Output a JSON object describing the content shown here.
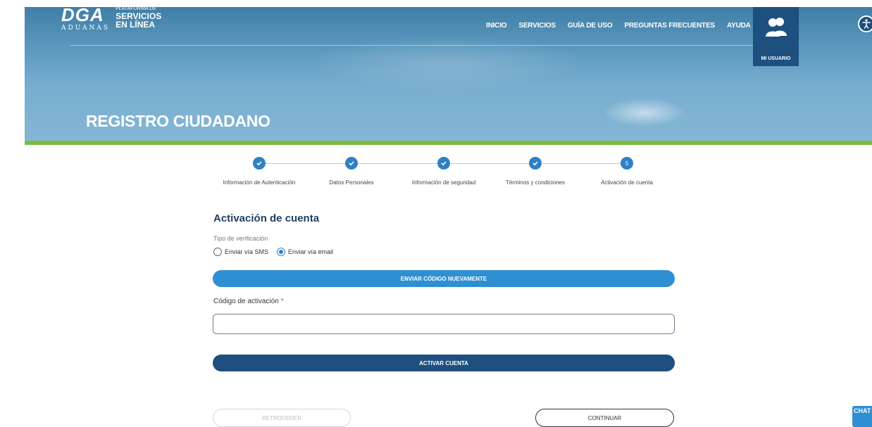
{
  "header": {
    "logo": {
      "mark": "DGA",
      "subtitle": "ADUANAS",
      "tagline_small": "PLATAFORMA DE",
      "tagline_line1": "SERVICIOS",
      "tagline_line2": "EN LÍNEA"
    },
    "nav": [
      "INICIO",
      "SERVICIOS",
      "GUÍA DE USO",
      "PREGUNTAS FRECUENTES",
      "AYUDA"
    ],
    "user_label": "MI USUARIO",
    "page_title": "REGISTRO CIUDADANO"
  },
  "stepper": {
    "steps": [
      {
        "label": "Información de Autenticación",
        "state": "done",
        "marker": ""
      },
      {
        "label": "Datos Personales",
        "state": "done",
        "marker": ""
      },
      {
        "label": "Información de seguridad",
        "state": "done",
        "marker": ""
      },
      {
        "label": "Términos y condiciones",
        "state": "done",
        "marker": ""
      },
      {
        "label": "Activación de cuenta",
        "state": "current",
        "marker": "5"
      }
    ]
  },
  "form": {
    "section_title": "Activación de cuenta",
    "verification_label": "Tipo de verificación",
    "options": [
      {
        "label": "Enviar vía SMS",
        "checked": false
      },
      {
        "label": "Enviar vía email",
        "checked": true
      }
    ],
    "resend_button": "ENVIAR CÓDIGO NUEVAMENTE",
    "code_label": "Código de activación",
    "code_required_mark": "*",
    "code_value": "",
    "activate_button": "ACTIVAR CUENTA"
  },
  "footer_buttons": {
    "back": "RETROCEDER",
    "continue": "CONTINUAR"
  },
  "chat_label": "CHAT",
  "colors": {
    "primary_dark": "#1d4f7f",
    "primary_light": "#2f8fd3",
    "accent_green": "#7dbb3f",
    "step_blue": "#2f80c4"
  }
}
